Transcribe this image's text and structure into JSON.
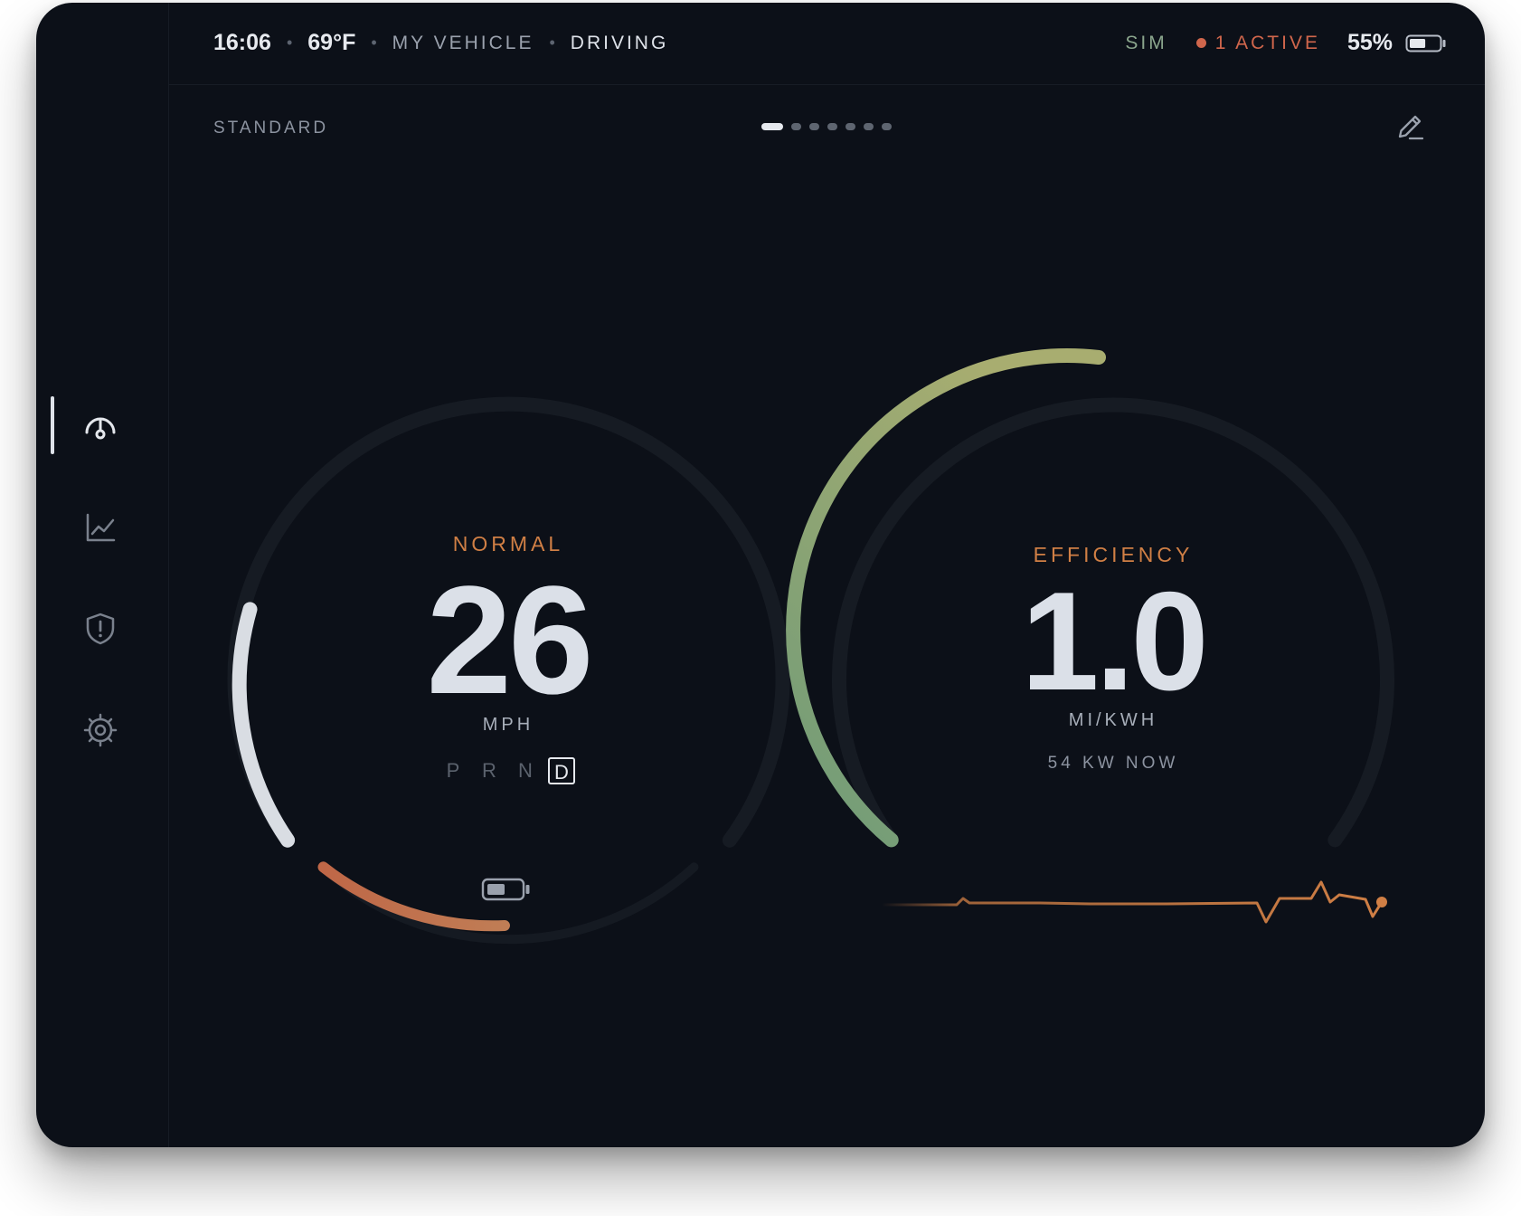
{
  "status": {
    "time": "16:06",
    "temperature": "69°F",
    "vehicle_name": "MY VEHICLE",
    "drive_state": "DRIVING",
    "mode_flag": "SIM",
    "alerts": "1 ACTIVE",
    "battery_percent": "55%",
    "battery_level": 0.55
  },
  "layout": {
    "name": "STANDARD",
    "page_count": 7,
    "active_page": 1
  },
  "sidebar": {
    "items": [
      {
        "icon": "speedometer-icon",
        "active": true
      },
      {
        "icon": "line-chart-icon",
        "active": false
      },
      {
        "icon": "shield-alert-icon",
        "active": false
      },
      {
        "icon": "gear-icon",
        "active": false
      }
    ]
  },
  "speed_gauge": {
    "mode": "NORMAL",
    "value": "26",
    "unit": "MPH",
    "gears": [
      "P",
      "R",
      "N",
      "D"
    ],
    "selected_gear": "D",
    "battery_arc_level": 0.55
  },
  "efficiency_gauge": {
    "label": "EFFICIENCY",
    "value": "1.0",
    "unit": "MI/KWH",
    "power_readout": "54 KW NOW"
  },
  "colors": {
    "background": "#0c1018",
    "accent_orange": "#d07f45",
    "alert_red": "#d0664c",
    "sim_green": "#8aa58c",
    "arc_track": "#161b23"
  }
}
